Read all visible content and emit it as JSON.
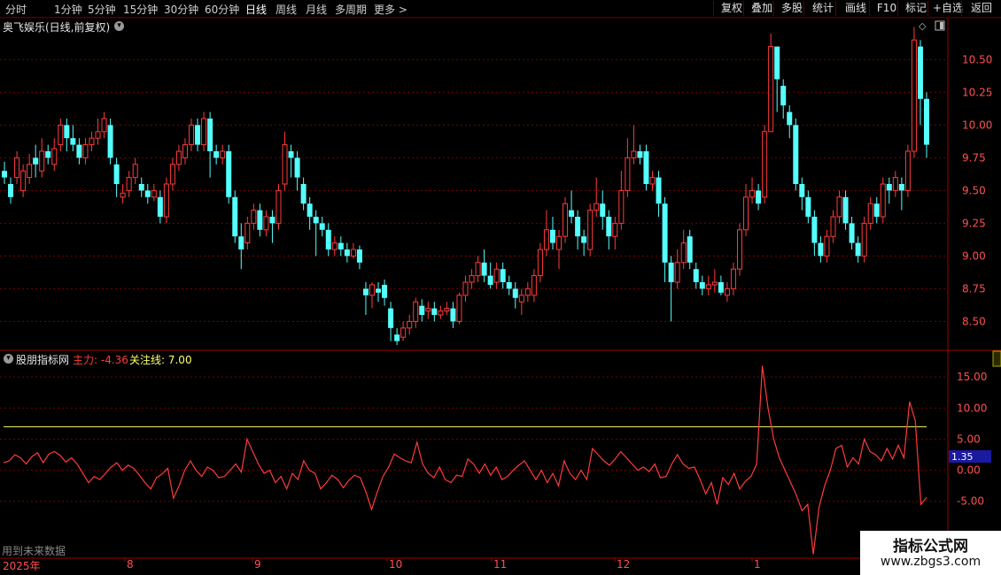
{
  "toolbar": {
    "periods": [
      "分时",
      "1分钟",
      "5分钟",
      "15分钟",
      "30分钟",
      "60分钟",
      "日线",
      "周线",
      "月线",
      "多周期",
      "更多 >"
    ],
    "active_period": "日线",
    "right_buttons": [
      "复权",
      "叠加",
      "多股",
      "统计",
      "画线",
      "F10",
      "标记",
      "+自选",
      "返回"
    ]
  },
  "main": {
    "title": "奥飞娱乐(日线,前复权)",
    "price_labels": [
      "10.50",
      "10.25",
      "10.00",
      "9.75",
      "9.50",
      "9.25",
      "9.00",
      "8.75",
      "8.50"
    ]
  },
  "indicator": {
    "title": "股朋指标网",
    "main_label": "主力: -4.36",
    "focus_label": "关注线: 7.00",
    "axis_labels": [
      "15.00",
      "10.00",
      "5.00",
      "0.00",
      "-5.00"
    ],
    "current_value": "1.35"
  },
  "dates": [
    "2025年",
    "8",
    "9",
    "10",
    "11",
    "12",
    "1"
  ],
  "footer_note": "用到未来数据",
  "watermark": {
    "title": "指标公式网",
    "url": "www.zbgs3.com"
  },
  "colors": {
    "up": "#ff3b3b",
    "down": "#54ffff",
    "grid": "#7a0000",
    "focus": "#ffff66"
  },
  "chart_data": [
    {
      "type": "candlestick",
      "title": "奥飞娱乐(日线,前复权)",
      "ylim": [
        8.3,
        10.8
      ],
      "y_ticks": [
        10.5,
        10.25,
        10.0,
        9.75,
        9.5,
        9.25,
        9.0,
        8.75,
        8.5
      ],
      "grid": true,
      "candles": [
        [
          9.65,
          9.6,
          9.72,
          9.55
        ],
        [
          9.55,
          9.45,
          9.6,
          9.4
        ],
        [
          9.6,
          9.75,
          9.8,
          9.55
        ],
        [
          9.5,
          9.65,
          9.7,
          9.45
        ],
        [
          9.6,
          9.7,
          9.78,
          9.55
        ],
        [
          9.75,
          9.7,
          9.85,
          9.6
        ],
        [
          9.65,
          9.8,
          9.9,
          9.6
        ],
        [
          9.8,
          9.75,
          9.85,
          9.7
        ],
        [
          9.7,
          9.82,
          9.9,
          9.65
        ],
        [
          9.85,
          10.0,
          10.05,
          9.8
        ],
        [
          10.0,
          9.9,
          10.05,
          9.8
        ],
        [
          9.9,
          9.85,
          10.0,
          9.8
        ],
        [
          9.85,
          9.75,
          9.9,
          9.7
        ],
        [
          9.75,
          9.85,
          9.9,
          9.7
        ],
        [
          9.85,
          9.9,
          9.95,
          9.8
        ],
        [
          9.9,
          9.95,
          10.05,
          9.85
        ],
        [
          9.95,
          10.05,
          10.1,
          9.9
        ],
        [
          10.0,
          9.75,
          10.05,
          9.7
        ],
        [
          9.7,
          9.55,
          9.75,
          9.45
        ],
        [
          9.45,
          9.48,
          9.55,
          9.4
        ],
        [
          9.5,
          9.6,
          9.65,
          9.45
        ],
        [
          9.6,
          9.7,
          9.75,
          9.55
        ],
        [
          9.55,
          9.5,
          9.6,
          9.45
        ],
        [
          9.5,
          9.45,
          9.55,
          9.4
        ],
        [
          9.45,
          9.5,
          9.55,
          9.42
        ],
        [
          9.45,
          9.3,
          9.5,
          9.25
        ],
        [
          9.3,
          9.55,
          9.6,
          9.25
        ],
        [
          9.55,
          9.7,
          9.75,
          9.5
        ],
        [
          9.7,
          9.8,
          9.85,
          9.65
        ],
        [
          9.75,
          9.85,
          9.9,
          9.7
        ],
        [
          9.85,
          10.0,
          10.05,
          9.8
        ],
        [
          10.0,
          9.85,
          10.05,
          9.8
        ],
        [
          9.85,
          10.05,
          10.1,
          9.8
        ],
        [
          10.05,
          9.8,
          10.1,
          9.6
        ],
        [
          9.8,
          9.75,
          9.85,
          9.7
        ],
        [
          9.75,
          9.8,
          9.85,
          9.7
        ],
        [
          9.8,
          9.45,
          9.85,
          9.4
        ],
        [
          9.45,
          9.15,
          9.5,
          9.1
        ],
        [
          9.15,
          9.05,
          9.25,
          8.9
        ],
        [
          9.1,
          9.25,
          9.3,
          9.05
        ],
        [
          9.25,
          9.35,
          9.4,
          9.2
        ],
        [
          9.35,
          9.2,
          9.4,
          9.15
        ],
        [
          9.2,
          9.3,
          9.35,
          9.15
        ],
        [
          9.3,
          9.25,
          9.35,
          9.1
        ],
        [
          9.25,
          9.5,
          9.55,
          9.2
        ],
        [
          9.55,
          9.85,
          9.95,
          9.5
        ],
        [
          9.8,
          9.75,
          9.85,
          9.6
        ],
        [
          9.75,
          9.6,
          9.8,
          9.5
        ],
        [
          9.55,
          9.4,
          9.6,
          9.35
        ],
        [
          9.4,
          9.3,
          9.45,
          9.2
        ],
        [
          9.3,
          9.25,
          9.35,
          9.0
        ],
        [
          9.25,
          9.2,
          9.3,
          9.15
        ],
        [
          9.2,
          9.05,
          9.25,
          9.0
        ],
        [
          9.05,
          9.1,
          9.15,
          9.0
        ],
        [
          9.1,
          9.05,
          9.15,
          9.0
        ],
        [
          9.05,
          9.0,
          9.1,
          8.95
        ],
        [
          9.0,
          9.05,
          9.1,
          8.98
        ],
        [
          9.05,
          8.95,
          9.08,
          8.9
        ],
        [
          8.75,
          8.7,
          8.8,
          8.55
        ],
        [
          8.7,
          8.78,
          8.8,
          8.6
        ],
        [
          8.75,
          8.72,
          8.8,
          8.65
        ],
        [
          8.78,
          8.68,
          8.82,
          8.62
        ],
        [
          8.6,
          8.45,
          8.65,
          8.35
        ],
        [
          8.4,
          8.35,
          8.45,
          8.32
        ],
        [
          8.38,
          8.45,
          8.5,
          8.35
        ],
        [
          8.45,
          8.5,
          8.55,
          8.4
        ],
        [
          8.5,
          8.65,
          8.68,
          8.45
        ],
        [
          8.62,
          8.55,
          8.67,
          8.5
        ],
        [
          8.58,
          8.6,
          8.65,
          8.52
        ],
        [
          8.6,
          8.55,
          8.65,
          8.5
        ],
        [
          8.55,
          8.58,
          8.62,
          8.52
        ],
        [
          8.58,
          8.6,
          8.65,
          8.55
        ],
        [
          8.6,
          8.5,
          8.65,
          8.45
        ],
        [
          8.5,
          8.7,
          8.72,
          8.48
        ],
        [
          8.7,
          8.8,
          8.85,
          8.65
        ],
        [
          8.8,
          8.85,
          8.9,
          8.75
        ],
        [
          8.85,
          8.95,
          9.0,
          8.8
        ],
        [
          8.95,
          8.85,
          9.05,
          8.8
        ],
        [
          8.85,
          8.78,
          8.95,
          8.75
        ],
        [
          8.8,
          8.9,
          8.95,
          8.75
        ],
        [
          8.9,
          8.8,
          8.95,
          8.75
        ],
        [
          8.8,
          8.75,
          8.85,
          8.7
        ],
        [
          8.75,
          8.68,
          8.8,
          8.6
        ],
        [
          8.65,
          8.7,
          8.75,
          8.55
        ],
        [
          8.7,
          8.75,
          8.8,
          8.65
        ],
        [
          8.7,
          8.85,
          8.9,
          8.65
        ],
        [
          8.85,
          9.05,
          9.1,
          8.8
        ],
        [
          9.05,
          9.2,
          9.35,
          9.0
        ],
        [
          9.2,
          9.1,
          9.3,
          9.05
        ],
        [
          9.05,
          9.15,
          9.2,
          8.9
        ],
        [
          9.15,
          9.4,
          9.45,
          9.1
        ],
        [
          9.35,
          9.3,
          9.5,
          9.25
        ],
        [
          9.3,
          9.15,
          9.35,
          9.05
        ],
        [
          9.15,
          9.1,
          9.2,
          9.0
        ],
        [
          9.05,
          9.35,
          9.4,
          9.0
        ],
        [
          9.35,
          9.4,
          9.6,
          9.3
        ],
        [
          9.4,
          9.3,
          9.5,
          9.2
        ],
        [
          9.3,
          9.15,
          9.35,
          9.05
        ],
        [
          9.15,
          9.25,
          9.3,
          9.05
        ],
        [
          9.25,
          9.5,
          9.65,
          9.2
        ],
        [
          9.5,
          9.75,
          9.9,
          9.45
        ],
        [
          9.75,
          9.8,
          10.0,
          9.7
        ],
        [
          9.8,
          9.75,
          9.85,
          9.7
        ],
        [
          9.8,
          9.55,
          9.85,
          9.5
        ],
        [
          9.55,
          9.6,
          9.65,
          9.5
        ],
        [
          9.6,
          9.4,
          9.65,
          9.3
        ],
        [
          9.4,
          8.95,
          9.45,
          8.8
        ],
        [
          8.95,
          8.8,
          9.0,
          8.5
        ],
        [
          8.8,
          8.95,
          9.05,
          8.75
        ],
        [
          8.95,
          9.1,
          9.2,
          8.9
        ],
        [
          9.15,
          8.95,
          9.2,
          8.9
        ],
        [
          8.9,
          8.8,
          8.95,
          8.75
        ],
        [
          8.8,
          8.75,
          8.85,
          8.7
        ],
        [
          8.75,
          8.78,
          8.85,
          8.7
        ],
        [
          8.78,
          8.8,
          8.9,
          8.72
        ],
        [
          8.8,
          8.72,
          8.85,
          8.7
        ],
        [
          8.7,
          8.75,
          8.8,
          8.65
        ],
        [
          8.75,
          8.9,
          8.95,
          8.7
        ],
        [
          8.9,
          9.2,
          9.25,
          8.85
        ],
        [
          9.2,
          9.45,
          9.55,
          9.15
        ],
        [
          9.45,
          9.5,
          9.6,
          9.4
        ],
        [
          9.5,
          9.4,
          9.55,
          9.35
        ],
        [
          9.45,
          9.95,
          10.0,
          9.4
        ],
        [
          9.95,
          10.6,
          10.7,
          9.95
        ],
        [
          10.6,
          10.35,
          10.6,
          10.1
        ],
        [
          10.3,
          10.15,
          10.35,
          10.05
        ],
        [
          10.1,
          10.0,
          10.15,
          9.9
        ],
        [
          10.0,
          9.55,
          10.05,
          9.5
        ],
        [
          9.55,
          9.45,
          9.6,
          9.35
        ],
        [
          9.45,
          9.3,
          9.5,
          9.25
        ],
        [
          9.3,
          9.1,
          9.35,
          9.0
        ],
        [
          9.1,
          9.0,
          9.15,
          8.95
        ],
        [
          9.0,
          9.15,
          9.2,
          8.95
        ],
        [
          9.15,
          9.3,
          9.35,
          9.1
        ],
        [
          9.3,
          9.45,
          9.5,
          9.25
        ],
        [
          9.45,
          9.25,
          9.5,
          9.2
        ],
        [
          9.25,
          9.1,
          9.3,
          9.05
        ],
        [
          9.1,
          9.0,
          9.15,
          8.95
        ],
        [
          9.0,
          9.25,
          9.3,
          8.95
        ],
        [
          9.25,
          9.4,
          9.45,
          9.2
        ],
        [
          9.4,
          9.3,
          9.45,
          9.25
        ],
        [
          9.3,
          9.55,
          9.6,
          9.25
        ],
        [
          9.55,
          9.5,
          9.6,
          9.4
        ],
        [
          9.5,
          9.6,
          9.65,
          9.45
        ],
        [
          9.55,
          9.5,
          9.6,
          9.35
        ],
        [
          9.5,
          9.8,
          9.85,
          9.45
        ],
        [
          9.8,
          10.65,
          10.75,
          9.75
        ],
        [
          10.6,
          10.2,
          10.65,
          10.0
        ],
        [
          10.2,
          9.85,
          10.25,
          9.75
        ]
      ]
    },
    {
      "type": "line",
      "title": "股朋指标网",
      "ylim": [
        -14,
        18
      ],
      "y_ticks": [
        15,
        10,
        5,
        0,
        -5
      ],
      "series": [
        {
          "name": "主力",
          "values": [
            1.2,
            1.5,
            2.5,
            2.0,
            1.0,
            2.2,
            2.8,
            1.2,
            2.6,
            3.0,
            2.4,
            1.3,
            2.0,
            1.0,
            -0.5,
            -2.0,
            -1.0,
            -1.5,
            -0.5,
            0.5,
            1.2,
            0.0,
            0.8,
            0.3,
            -0.8,
            -2.0,
            -3.0,
            -1.2,
            -0.6,
            0.3,
            -4.5,
            -2.5,
            0.0,
            1.5,
            0.0,
            -1.0,
            0.5,
            0.0,
            -1.2,
            -1.0,
            0.0,
            1.0,
            -0.3,
            5.0,
            3.0,
            1.0,
            -0.5,
            0.0,
            -2.0,
            -1.0,
            -3.0,
            -0.5,
            -1.5,
            1.5,
            0.0,
            -0.5,
            -3.0,
            -2.0,
            -0.8,
            -1.5,
            -2.8,
            -1.6,
            -0.8,
            -1.2,
            -3.5,
            -6.3,
            -3.5,
            -1.0,
            0.5,
            2.6,
            2.0,
            1.5,
            1.2,
            4.5,
            1.0,
            -0.5,
            -1.2,
            0.5,
            -1.5,
            -2.0,
            -0.8,
            -1.0,
            1.8,
            1.0,
            -0.5,
            1.0,
            -0.8,
            0.5,
            -1.5,
            -1.0,
            0.0,
            0.8,
            1.5,
            0.0,
            -1.5,
            0.0,
            -2.0,
            -0.5,
            -2.5,
            1.5,
            -0.5,
            -1.5,
            0.0,
            -1.5,
            3.5,
            2.5,
            1.5,
            0.8,
            1.8,
            3.0,
            2.0,
            1.0,
            0.0,
            0.5,
            -0.2,
            1.0,
            -1.2,
            -1.0,
            1.0,
            2.5,
            1.0,
            0.3,
            0.5,
            -1.5,
            -3.8,
            -2.0,
            -5.5,
            -1.2,
            -2.3,
            -0.5,
            -3.0,
            -1.8,
            -1.0,
            1.0,
            16.8,
            10.0,
            5.0,
            2.0,
            0.0,
            -2.0,
            -4.0,
            -6.5,
            -5.5,
            -13.5,
            -6.0,
            -2.5,
            0.0,
            3.5,
            4.0,
            0.5,
            2.0,
            1.0,
            5.0,
            3.0,
            2.5,
            1.5,
            3.5,
            1.8,
            4.0,
            2.0,
            11.0,
            8.0,
            -5.5,
            -4.36
          ]
        },
        {
          "name": "关注线",
          "values": [
            7.0
          ]
        }
      ]
    }
  ]
}
